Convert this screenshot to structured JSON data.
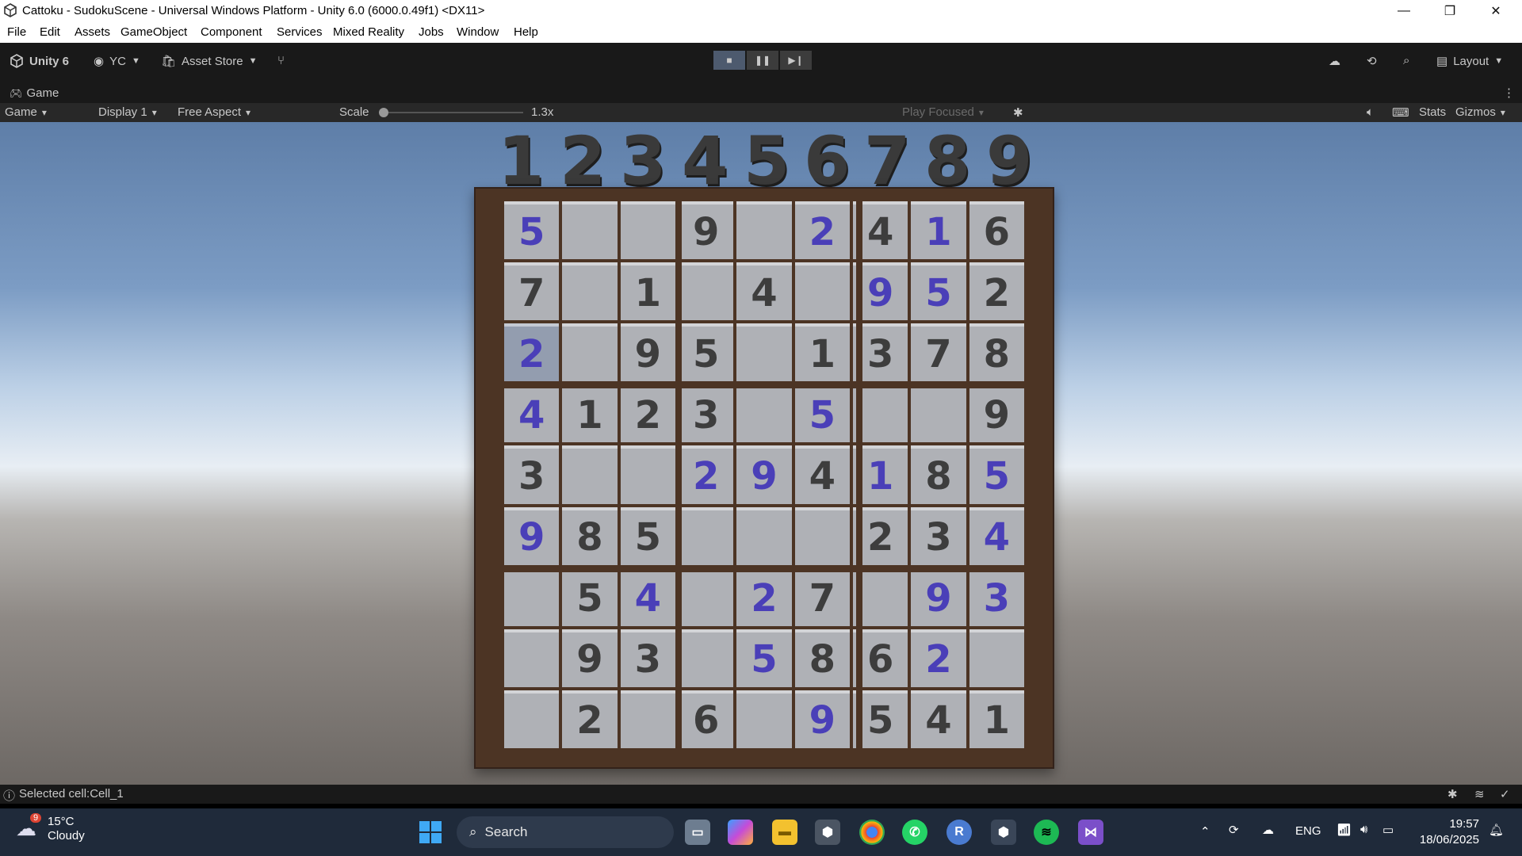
{
  "window": {
    "title": "Cattoku - SudokuScene - Universal Windows Platform - Unity 6.0 (6000.0.49f1) <DX11>"
  },
  "menu": [
    "File",
    "Edit",
    "Assets",
    "GameObject",
    "Component",
    "Services",
    "Mixed Reality",
    "Jobs",
    "Window",
    "Help"
  ],
  "toolbar": {
    "unity_label": "Unity 6",
    "account": "YC",
    "asset_store": "Asset Store",
    "layout": "Layout"
  },
  "game_tab": {
    "label": "Game"
  },
  "game_controls": {
    "mode": "Game",
    "display": "Display 1",
    "aspect": "Free Aspect",
    "scale_label": "Scale",
    "scale_value": "1.3x",
    "play_focused": "Play Focused",
    "stats": "Stats",
    "gizmos": "Gizmos"
  },
  "header_numbers": [
    "1",
    "2",
    "3",
    "4",
    "5",
    "6",
    "7",
    "8",
    "9"
  ],
  "board": {
    "selected_cell": 18,
    "rows": [
      [
        "5",
        "",
        "",
        "9",
        "",
        "2",
        "4",
        "1",
        "6"
      ],
      [
        "7",
        "",
        "1",
        "",
        "4",
        "",
        "9",
        "5",
        "2"
      ],
      [
        "2",
        "",
        "9",
        "5",
        "",
        "1",
        "3",
        "7",
        "8"
      ],
      [
        "4",
        "1",
        "2",
        "3",
        "",
        "5",
        "",
        "",
        "9"
      ],
      [
        "3",
        "",
        "",
        "2",
        "9",
        "4",
        "1",
        "8",
        "5"
      ],
      [
        "9",
        "8",
        "5",
        "",
        "",
        "",
        "2",
        "3",
        "4"
      ],
      [
        "",
        "5",
        "4",
        "",
        "2",
        "7",
        "",
        "9",
        "3"
      ],
      [
        "",
        "9",
        "3",
        "",
        "5",
        "8",
        "6",
        "2",
        ""
      ],
      [
        "",
        "2",
        "",
        "6",
        "",
        "9",
        "5",
        "4",
        "1"
      ]
    ],
    "kinds": [
      [
        "u",
        "",
        "",
        "g",
        "",
        "u",
        "g",
        "u",
        "g"
      ],
      [
        "g",
        "",
        "g",
        "",
        "g",
        "",
        "u",
        "u",
        "g"
      ],
      [
        "u",
        "",
        "g",
        "g",
        "",
        "g",
        "g",
        "g",
        "g"
      ],
      [
        "u",
        "g",
        "g",
        "g",
        "",
        "u",
        "",
        "",
        "g"
      ],
      [
        "g",
        "",
        "",
        "u",
        "u",
        "g",
        "u",
        "g",
        "u"
      ],
      [
        "u",
        "g",
        "g",
        "",
        "",
        "",
        "g",
        "g",
        "u"
      ],
      [
        "",
        "g",
        "u",
        "",
        "u",
        "g",
        "",
        "u",
        "u"
      ],
      [
        "",
        "g",
        "g",
        "",
        "u",
        "g",
        "g",
        "u",
        ""
      ],
      [
        "",
        "g",
        "",
        "g",
        "",
        "u",
        "g",
        "g",
        "g"
      ]
    ]
  },
  "status": {
    "message": "Selected cell:Cell_1"
  },
  "taskbar": {
    "weather_temp": "15°C",
    "weather_desc": "Cloudy",
    "weather_badge": "9",
    "search": "Search",
    "lang": "ENG",
    "time": "19:57",
    "date": "18/06/2025"
  },
  "colors": {
    "given": "#3d3d3d",
    "user": "#4a3fb8",
    "frame": "#4c3424"
  }
}
